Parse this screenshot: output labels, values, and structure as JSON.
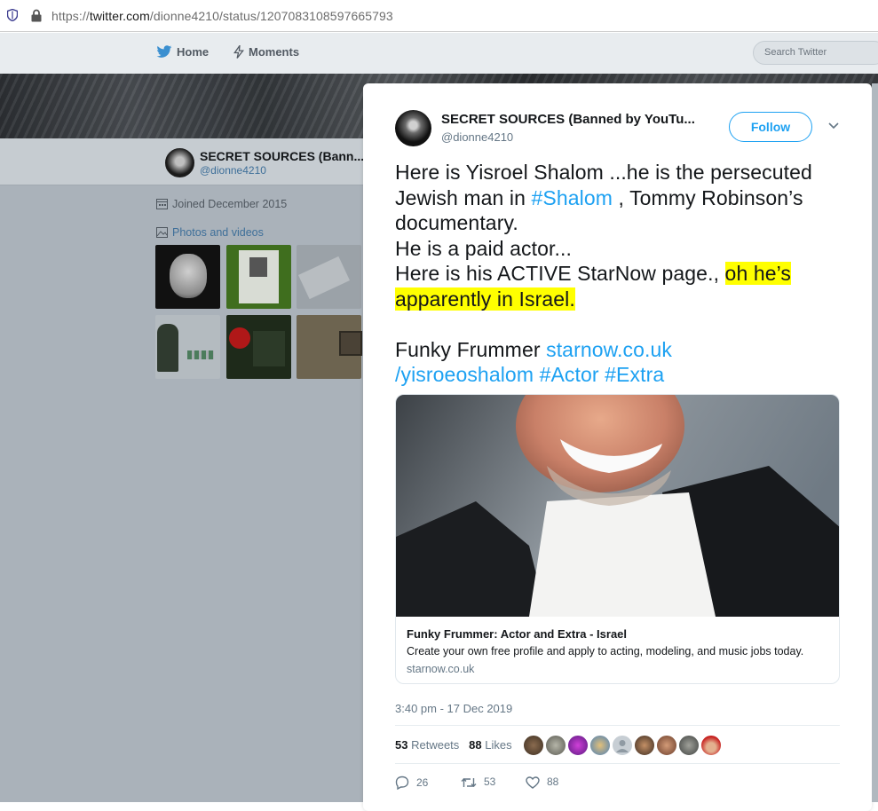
{
  "browser": {
    "url_prefix": "https://",
    "url_domain": "twitter.com",
    "url_path": "/dionne4210/status/1207083108597665793"
  },
  "nav": {
    "home": "Home",
    "moments": "Moments",
    "search_placeholder": "Search Twitter"
  },
  "profile": {
    "name": "SECRET SOURCES (Bann...",
    "handle": "@dionne4210",
    "joined": "Joined December 2015",
    "photos_label": "Photos and videos"
  },
  "tweet": {
    "author_name": "SECRET SOURCES (Banned by YouTu...",
    "author_handle": "@dionne4210",
    "follow_label": "Follow",
    "line1": "Here is Yisroel Shalom ...he is the persecuted",
    "line2_pre": "Jewish man in ",
    "line2_tag": "#Shalom",
    "line2_post": " , Tommy Robinson’s",
    "line3": "documentary.",
    "line4": "He is a paid actor...",
    "line5_pre": "Here is his ACTIVE StarNow page., ",
    "line5_hl": "oh he’s",
    "line6_hl": "apparently in Israel.",
    "line7": "Funky  Frummer ",
    "line7_link": "starnow.co.uk",
    "line8_link": "/yisroeoshalom",
    "line8_tag1": "#Actor",
    "line8_tag2": "#Extra",
    "card_title": "Funky Frummer: Actor and Extra - Israel",
    "card_desc": "Create your own free profile and apply to acting, modeling, and music jobs today.",
    "card_domain": "starnow.co.uk",
    "timestamp": "3:40 pm - 17 Dec 2019",
    "retweets_count": "53",
    "retweets_label": "Retweets",
    "likes_count": "88",
    "likes_label": "Likes",
    "reply_count": "26",
    "retweet_action_count": "53",
    "like_action_count": "88"
  },
  "colors": {
    "accent": "#1da1f2",
    "highlight": "#ffff00"
  }
}
